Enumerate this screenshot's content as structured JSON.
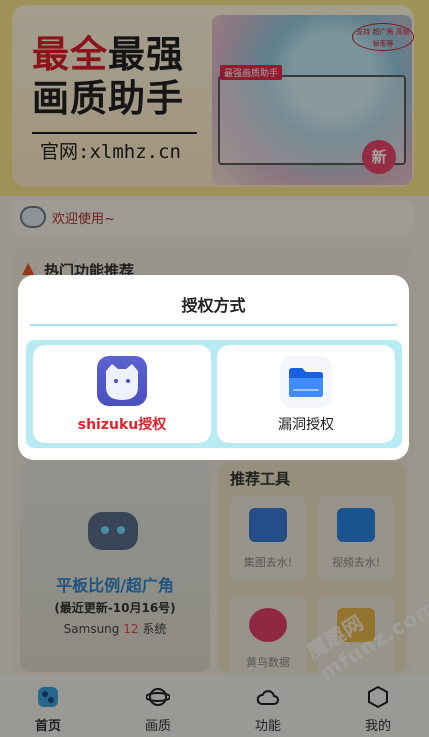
{
  "banner": {
    "line1_red": "最全",
    "line1_dark": "最强",
    "line2": "画质助手",
    "site": "官网:xlmhz.cn",
    "chip": "最强画质助手",
    "tag": "支持 超广角 高帧 帧率等",
    "badge": "新"
  },
  "welcome": {
    "text": "欢迎使用~"
  },
  "hot": {
    "title": "热门功能推荐"
  },
  "tablet": {
    "title": "平板比例/超广角",
    "update": "(最近更新-10月16号)",
    "sys_prefix": "Samsung ",
    "sys_num": "12",
    "sys_suffix": " 系统"
  },
  "tools": {
    "title": "推荐工具",
    "items": [
      {
        "label": "集图去水!",
        "icon": "image-icon",
        "color": "#3a7bd5"
      },
      {
        "label": "视频去水!",
        "icon": "video-icon",
        "color": "#2a86e0"
      },
      {
        "label": "黄鸟数据",
        "icon": "plus-icon",
        "color": "#e0406a"
      },
      {
        "label": "",
        "icon": "clipboard-icon",
        "color": "#e8b64a"
      }
    ]
  },
  "tabbar": {
    "tabs": [
      {
        "label": "首页",
        "icon": "home-icon"
      },
      {
        "label": "画质",
        "icon": "planet-icon"
      },
      {
        "label": "功能",
        "icon": "cloud-icon"
      },
      {
        "label": "我的",
        "icon": "cube-icon"
      }
    ]
  },
  "watermark": "魔趣网 mfunz.com",
  "dialog": {
    "title": "授权方式",
    "options": [
      {
        "label": "shizuku授权",
        "icon": "shizuku-icon"
      },
      {
        "label": "漏洞授权",
        "icon": "folder-icon"
      }
    ]
  },
  "colors": {
    "accent": "#2f86c8",
    "shizuku_label": "#e0242c",
    "dialog_border": "#b8eaf3"
  }
}
